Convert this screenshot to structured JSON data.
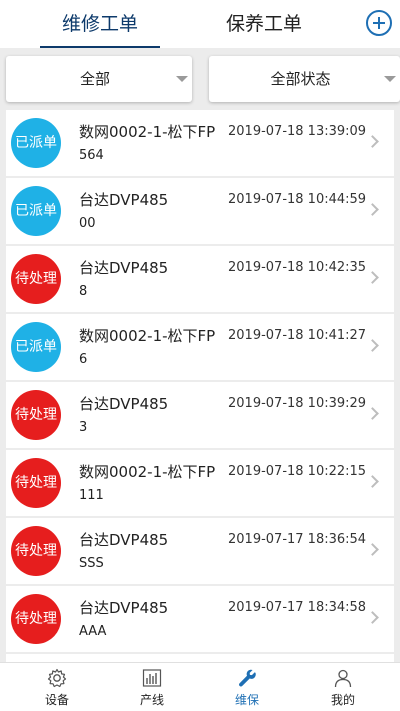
{
  "header": {
    "tabs": [
      {
        "label": "维修工单",
        "active": true
      },
      {
        "label": "保养工单",
        "active": false
      }
    ],
    "add_icon": "plus-circle-icon"
  },
  "filters": {
    "scope": "全部",
    "status": "全部状态"
  },
  "orders": [
    {
      "status": "已派单",
      "device": "数网0002-1-松下FP",
      "code": "564",
      "time": "2019-07-18 13:39:09"
    },
    {
      "status": "已派单",
      "device": "台达DVP485",
      "code": "00",
      "time": "2019-07-18 10:44:59"
    },
    {
      "status": "待处理",
      "device": "台达DVP485",
      "code": "8",
      "time": "2019-07-18 10:42:35"
    },
    {
      "status": "已派单",
      "device": "数网0002-1-松下FP",
      "code": "6",
      "time": "2019-07-18 10:41:27"
    },
    {
      "status": "待处理",
      "device": "台达DVP485",
      "code": "3",
      "time": "2019-07-18 10:39:29"
    },
    {
      "status": "待处理",
      "device": "数网0002-1-松下FP",
      "code": "111",
      "time": "2019-07-18 10:22:15"
    },
    {
      "status": "待处理",
      "device": "台达DVP485",
      "code": "SSS",
      "time": "2019-07-17 18:36:54"
    },
    {
      "status": "待处理",
      "device": "台达DVP485",
      "code": "AAA",
      "time": "2019-07-17 18:34:58"
    }
  ],
  "colors": {
    "dispatched": "#1fb1e6",
    "pending": "#e61e1e",
    "accent": "#1e6fb4"
  },
  "bottom_nav": [
    {
      "label": "设备",
      "icon": "gear-icon",
      "active": false
    },
    {
      "label": "产线",
      "icon": "bar-chart-icon",
      "active": false
    },
    {
      "label": "维保",
      "icon": "wrench-icon",
      "active": true
    },
    {
      "label": "我的",
      "icon": "user-icon",
      "active": false
    }
  ]
}
